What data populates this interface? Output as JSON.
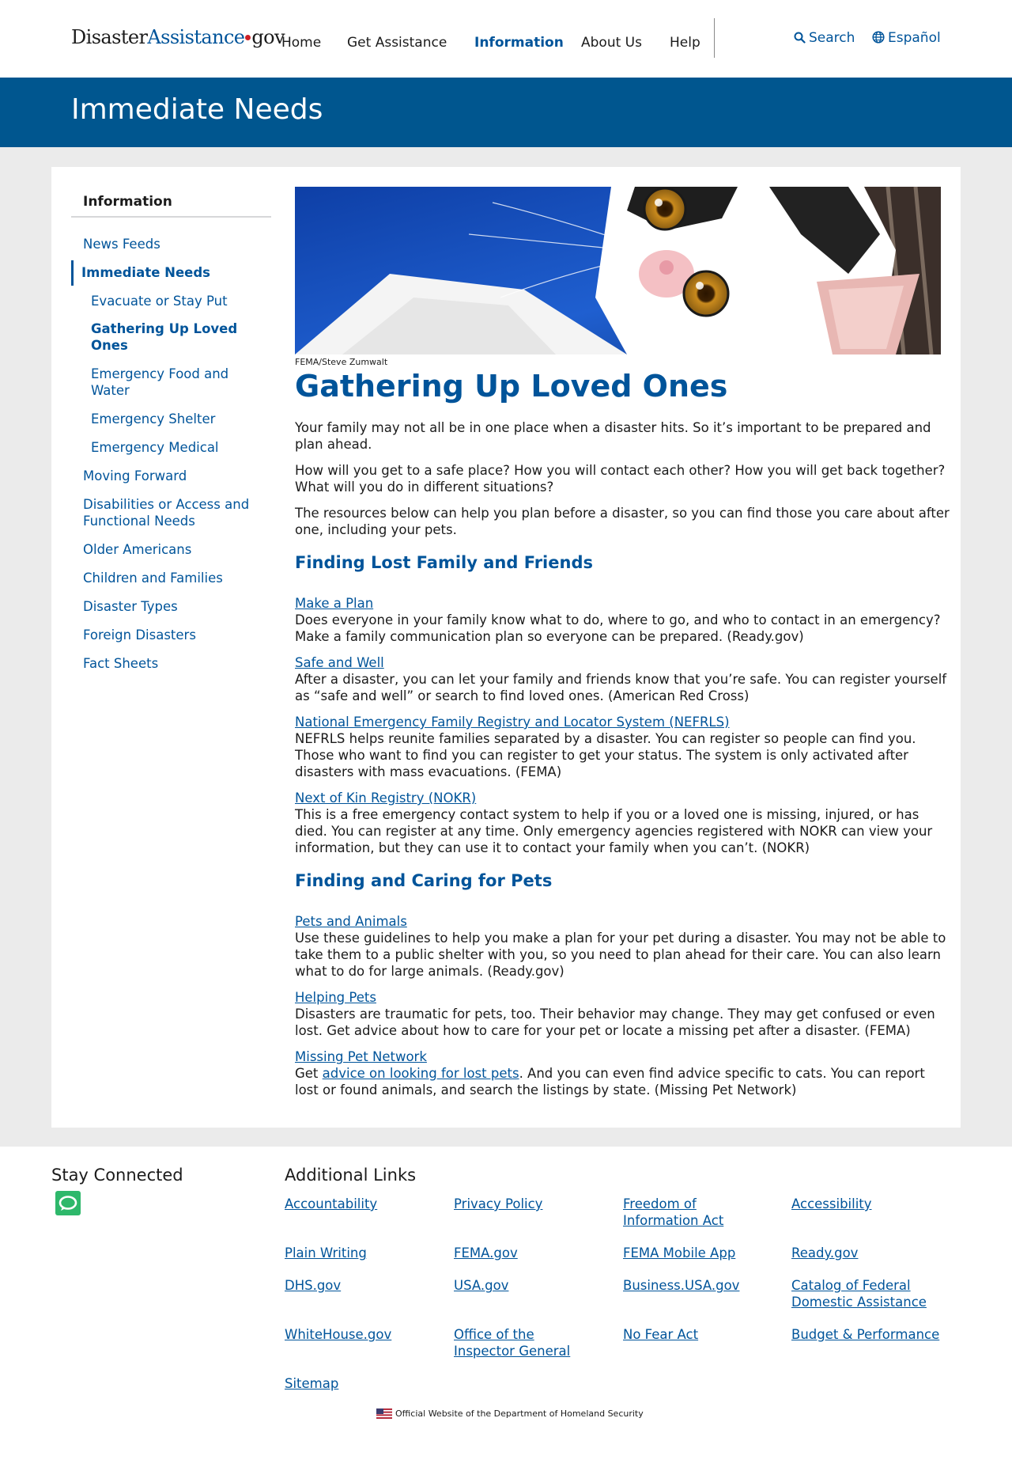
{
  "header": {
    "logo": {
      "part1": "Disaster",
      "part2": "Assistance",
      "part3": "gov"
    },
    "nav": [
      "Home",
      "Get Assistance",
      "Information",
      "About Us",
      "Help"
    ],
    "search_label": "Search",
    "language_label": "Español"
  },
  "banner": {
    "title": "Immediate Needs"
  },
  "sidebar": {
    "heading": "Information",
    "items": [
      "News Feeds",
      "Immediate Needs",
      "Evacuate or Stay Put",
      "Gathering Up Loved Ones",
      "Emergency Food and Water",
      "Emergency Shelter",
      "Emergency Medical",
      "Moving Forward",
      "Disabilities or Access and Functional Needs",
      "Older Americans",
      "Children and Families",
      "Disaster Types",
      "Foreign Disasters",
      "Fact Sheets"
    ]
  },
  "main": {
    "photo_credit": "FEMA/Steve Zumwalt",
    "title": "Gathering Up Loved Ones",
    "intro": [
      "Your family may not all be in one place when a disaster hits. So it’s important to be prepared and plan ahead.",
      "How will you get to a safe place? How you will contact each other? How you will get back together? What will you do in different situations?",
      "The resources below can help you plan before a disaster, so you can find those you care about after one, including your pets."
    ],
    "section1": {
      "heading": "Finding Lost Family and Friends",
      "resources": [
        {
          "title": "Make a Plan",
          "desc": "Does everyone in your family know what to do, where to go, and who to contact in an emergency? Make a family communication plan so everyone can be prepared. (Ready.gov)"
        },
        {
          "title": "Safe and Well",
          "desc": "After a disaster, you can let your family and friends know that you’re safe. You can register yourself as “safe and well” or search to find loved ones. (American Red Cross)"
        },
        {
          "title": "National Emergency Family Registry and Locator System (NEFRLS)",
          "desc": "NEFRLS helps reunite families separated by a disaster. You can register so people can find you. Those who want to find you can register to get your status. The system is only activated after disasters with mass evacuations. (FEMA)"
        },
        {
          "title": "Next of Kin Registry (NOKR)",
          "desc": "This is a free emergency contact system to help if you or a loved one is missing, injured, or has died. You can register at any time. Only emergency agencies registered with NOKR can view your information, but they can use it to contact your family when you can’t. (NOKR)"
        }
      ]
    },
    "section2": {
      "heading": "Finding and Caring for Pets",
      "resources": [
        {
          "title": "Pets and Animals",
          "desc": "Use these guidelines to help you make a plan for your pet during a disaster. You may not be able to take them to a public shelter with you, so you need to plan ahead for their care. You can also learn what to do for large animals. (Ready.gov)"
        },
        {
          "title": "Helping Pets",
          "desc": "Disasters are traumatic for pets, too. Their behavior may change. They may get confused or even lost. Get advice about how to care for your pet or locate a missing pet after a disaster. (FEMA)"
        },
        {
          "title": "Missing Pet Network",
          "desc_pre": "Get ",
          "desc_link": "advice on looking for lost pets",
          "desc_post": ". And you can even find advice specific to cats. You can report lost or found animals, and search the listings by state. (Missing Pet Network)"
        }
      ]
    }
  },
  "footer": {
    "stay_connected": "Stay Connected",
    "additional_links": "Additional Links",
    "links": [
      "Accountability",
      "Privacy Policy",
      "Freedom of Information Act",
      "Accessibility",
      "Plain Writing",
      "FEMA.gov",
      "FEMA Mobile App",
      "Ready.gov",
      "DHS.gov",
      "USA.gov",
      "Business.USA.gov",
      "Catalog of Federal Domestic Assistance",
      "WhiteHouse.gov",
      "Office of the Inspector General",
      "No Fear Act",
      "Budget & Performance",
      "Sitemap"
    ],
    "official": "Official Website of the Department of Homeland Security"
  },
  "colors": {
    "brand_blue": "#00549a",
    "banner_blue": "#00568f",
    "logo_dot": "#cd2026",
    "chat_green": "#2eb86b"
  }
}
